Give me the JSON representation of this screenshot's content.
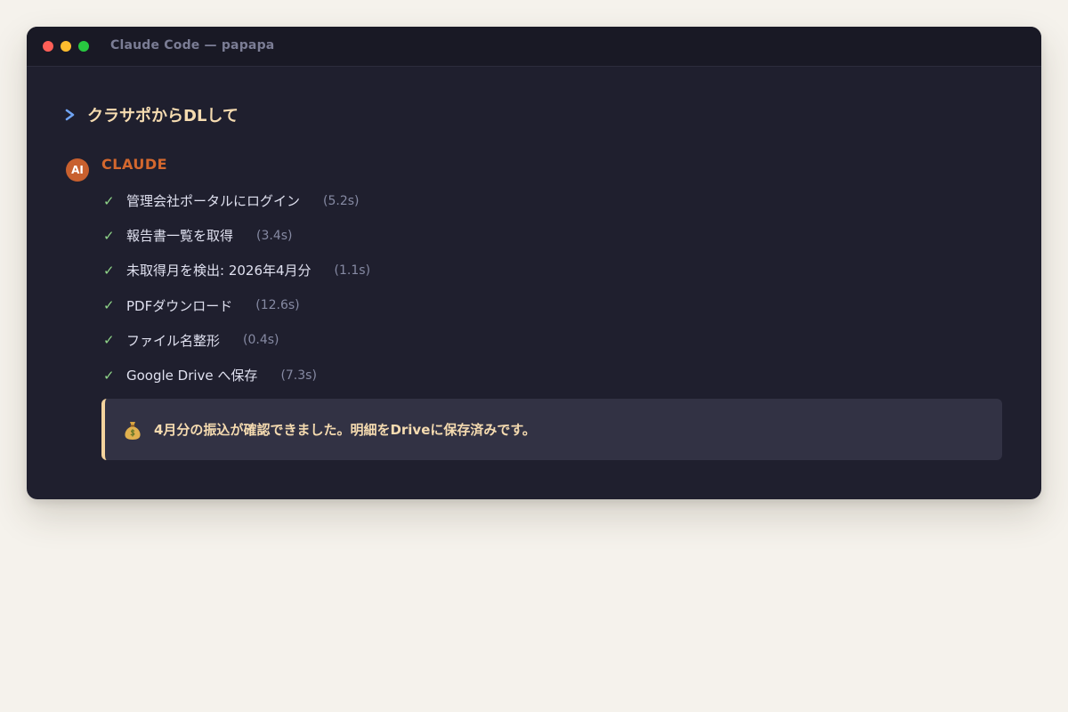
{
  "window": {
    "title": "Claude Code — papapa"
  },
  "user_prompt": {
    "text": "クラサポからDLして"
  },
  "assistant": {
    "avatar_label": "AI",
    "name": "CLAUDE",
    "check_symbol": "✓",
    "steps": [
      {
        "label": "管理会社ポータルにログイン",
        "time": "(5.2s)",
        "status": "done"
      },
      {
        "label": "報告書一覧を取得",
        "time": "(3.4s)",
        "status": "done"
      },
      {
        "label": "未取得月を検出: 2026年4月分",
        "time": "(1.1s)",
        "status": "done"
      },
      {
        "label": "PDFダウンロード",
        "time": "(12.6s)",
        "status": "done"
      },
      {
        "label": "ファイル名整形",
        "time": "(0.4s)",
        "status": "done"
      },
      {
        "label": "Google Drive へ保存",
        "time": "(7.3s)",
        "status": "done"
      }
    ],
    "result": {
      "icon": "money-bag-icon",
      "text": "4月分の振込が確認できました。明細をDriveに保存済みです。"
    }
  },
  "colors": {
    "page_background": "#f5f2ec",
    "window_background": "#1f1f2e",
    "titlebar_background": "#191925",
    "accent_orange": "#d4682e",
    "prompt_text": "#f5dbb0",
    "check_green": "#8fd488",
    "chevron_blue": "#6fa3f2",
    "callout_background": "#323244",
    "callout_border": "#f5d49e"
  }
}
